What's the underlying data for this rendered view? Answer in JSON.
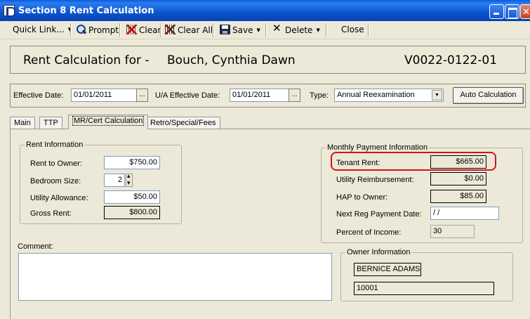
{
  "window": {
    "title": "Section 8 Rent Calculation"
  },
  "toolbar": {
    "quick_link": "Quick Link...",
    "prompt": "Prompt",
    "clear": "Clear",
    "clear_all": "Clear All",
    "save": "Save",
    "delete": "Delete",
    "close": "Close"
  },
  "header": {
    "label": "Rent Calculation for -",
    "name": "Bouch, Cynthia Dawn",
    "id": "V0022-0122-01"
  },
  "effective": {
    "effective_date_label": "Effective Date:",
    "effective_date": "01/01/2011",
    "ua_date_label": "U/A Effective Date:",
    "ua_date": "01/01/2011",
    "type_label": "Type:",
    "type_value": "Annual Reexamination",
    "auto_calc": "Auto Calculation",
    "dots": "..."
  },
  "tabs": [
    {
      "label": "Main"
    },
    {
      "label": "TTP"
    },
    {
      "label": "MR/Cert Calculation"
    },
    {
      "label": "Retro/Special/Fees"
    }
  ],
  "rent_info": {
    "title": "Rent Information",
    "rent_to_owner_label": "Rent to Owner:",
    "rent_to_owner": "$750.00",
    "bedroom_size_label": "Bedroom Size:",
    "bedroom_size": "2",
    "utility_allowance_label": "Utility Allowance:",
    "utility_allowance": "$50.00",
    "gross_rent_label": "Gross Rent:",
    "gross_rent": "$800.00"
  },
  "monthly": {
    "title": "Monthly Payment Information",
    "tenant_rent_label": "Tenant Rent:",
    "tenant_rent": "$665.00",
    "utility_reimb_label": "Utility Reimbursement:",
    "utility_reimb": "$0.00",
    "hap_label": "HAP to Owner:",
    "hap": "$85.00",
    "next_reg_label": "Next Reg Payment Date:",
    "next_reg": " / /",
    "percent_income_label": "Percent of Income:",
    "percent_income": "30"
  },
  "comment": {
    "label": "Comment:"
  },
  "owner": {
    "title": "Owner Information",
    "name": "BERNICE ADAMS",
    "id": "10001"
  },
  "colors": {
    "highlight": "#d8121a",
    "titlebar": "#0a55d0"
  }
}
